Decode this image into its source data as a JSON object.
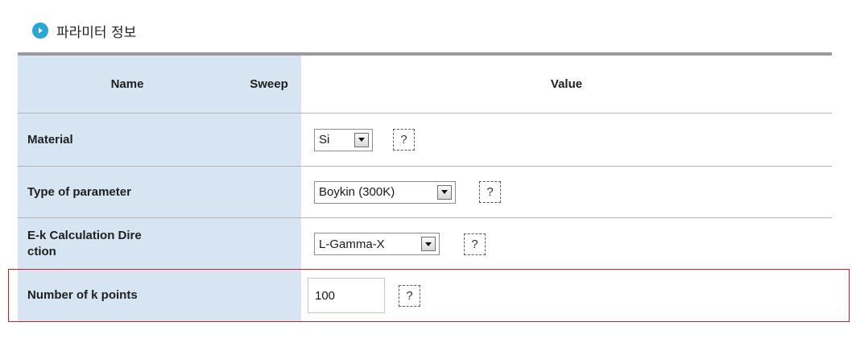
{
  "section": {
    "title": "파라미터 정보",
    "icon": "play-circle-icon",
    "icon_color": "#2aa6d6"
  },
  "table": {
    "headers": {
      "name": "Name",
      "sweep": "Sweep",
      "value": "Value"
    },
    "rows": [
      {
        "name": "Material",
        "control": "select",
        "value": "Si"
      },
      {
        "name": "Type of parameter",
        "control": "select",
        "value": "Boykin (300K)"
      },
      {
        "name_line1": "E-k Calculation Dire",
        "name_line2": "ction",
        "control": "select",
        "value": "L-Gamma-X"
      },
      {
        "name": "Number of k points",
        "control": "text-input",
        "value": "100"
      }
    ],
    "help_label": "?"
  },
  "colors": {
    "name_column_bg": "#d6e5f1",
    "top_border": "#9a9a9a",
    "highlight": "#c8202e"
  }
}
